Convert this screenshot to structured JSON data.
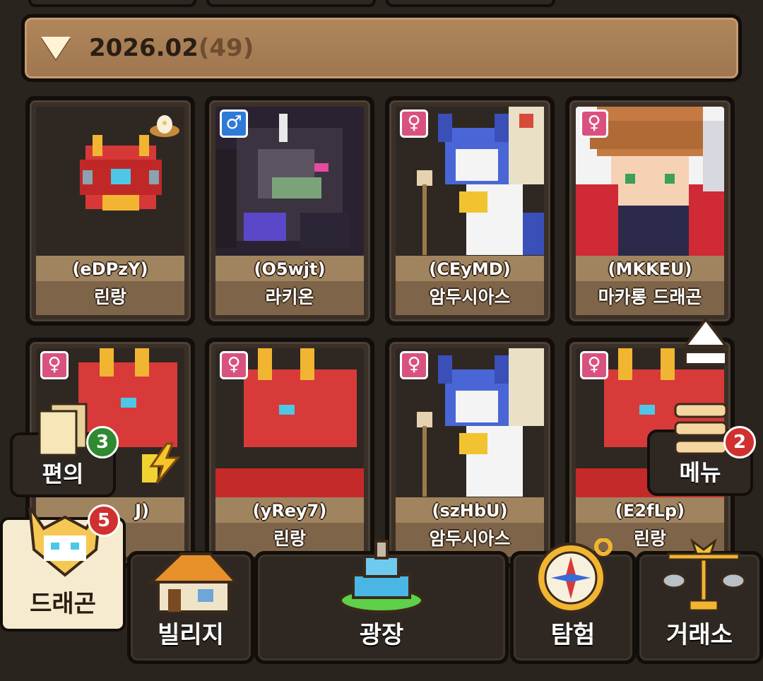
{
  "date_header": {
    "date": "2026.02",
    "count": "(49)"
  },
  "cards": [
    {
      "code": "(eDPzY)",
      "name": "린랑",
      "gender": "",
      "art": "egg-dragon",
      "icon": "nest-egg-icon"
    },
    {
      "code": "(O5wjt)",
      "name": "라키온",
      "gender": "male",
      "art": "dark-dragon"
    },
    {
      "code": "(CEyMD)",
      "name": "암두시아스",
      "gender": "female",
      "art": "blue-cat"
    },
    {
      "code": "(MKKEU)",
      "name": "마카롱 드래곤",
      "gender": "female",
      "art": "macaron"
    },
    {
      "code": "",
      "name": "",
      "gender": "female",
      "art": "red-dragon"
    },
    {
      "code": "(yRey7)",
      "name": "린랑",
      "gender": "female",
      "art": "red-dragon"
    },
    {
      "code": "(szHbU)",
      "name": "암두시아스",
      "gender": "female",
      "art": "blue-cat"
    },
    {
      "code": "(E2fLp)",
      "name": "린랑",
      "gender": "female",
      "art": "red-dragon"
    }
  ],
  "gender_symbols": {
    "female": "♀",
    "male": "♂"
  },
  "partial_card5_code": "J)",
  "side_buttons": {
    "convenience": {
      "label": "편의",
      "badge": "3"
    },
    "menu": {
      "label": "메뉴",
      "badge": "2"
    }
  },
  "bottom_nav": {
    "dragon": {
      "label": "드래곤",
      "badge": "5",
      "active": true
    },
    "village": {
      "label": "빌리지"
    },
    "plaza": {
      "label": "광장"
    },
    "explore": {
      "label": "탐험"
    },
    "exchange": {
      "label": "거래소"
    }
  },
  "colors": {
    "accent_red": "#d03030",
    "accent_green": "#2f8a32",
    "header_bar": "#a67d55"
  }
}
